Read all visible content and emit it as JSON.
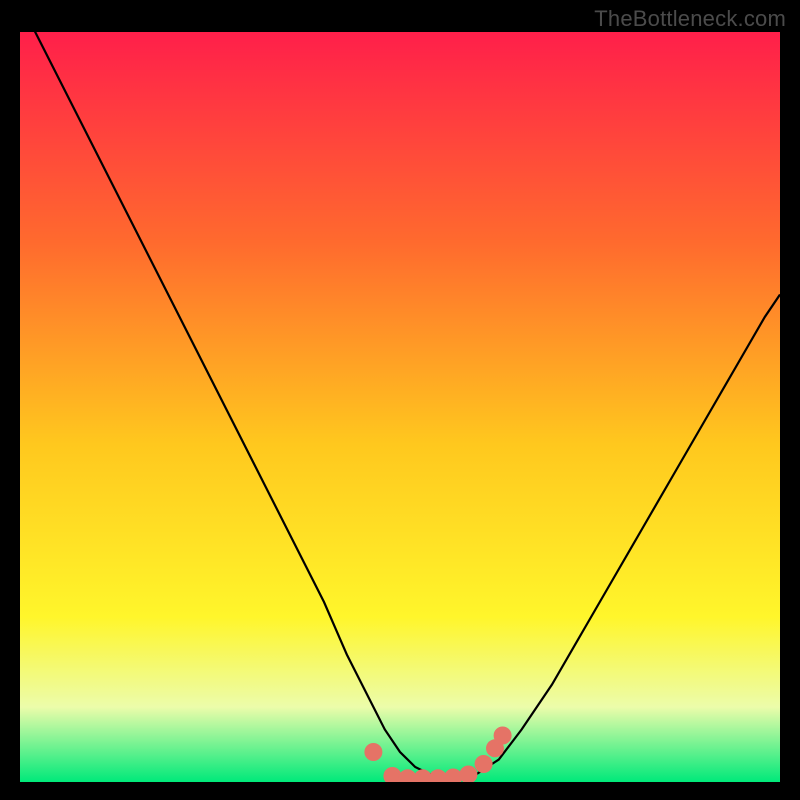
{
  "attribution": "TheBottleneck.com",
  "colors": {
    "frame": "#000000",
    "gradient_top": "#ff1f4a",
    "gradient_mid1": "#ff6a2e",
    "gradient_mid2": "#ffc81e",
    "gradient_mid3": "#fff62b",
    "gradient_mid4": "#ecfcaa",
    "gradient_bottom": "#00e97a",
    "curve": "#000000",
    "marker": "#e57366"
  },
  "chart_data": {
    "type": "line",
    "title": "",
    "xlabel": "",
    "ylabel": "",
    "xlim": [
      0,
      100
    ],
    "ylim": [
      0,
      100
    ],
    "series": [
      {
        "name": "bottleneck-curve",
        "x": [
          0,
          4,
          8,
          12,
          16,
          20,
          24,
          28,
          32,
          36,
          40,
          43,
          46,
          48,
          50,
          52,
          54,
          56,
          58,
          60,
          63,
          66,
          70,
          74,
          78,
          82,
          86,
          90,
          94,
          98,
          100
        ],
        "values": [
          104,
          96,
          88,
          80,
          72,
          64,
          56,
          48,
          40,
          32,
          24,
          17,
          11,
          7,
          4,
          2,
          1,
          0.5,
          0.5,
          1,
          3,
          7,
          13,
          20,
          27,
          34,
          41,
          48,
          55,
          62,
          65
        ]
      }
    ],
    "markers": [
      {
        "name": "left-edge-dot",
        "x": 46.5,
        "y": 4.0
      },
      {
        "name": "flat-start",
        "x": 49.0,
        "y": 0.8
      },
      {
        "name": "flat-a",
        "x": 51.0,
        "y": 0.5
      },
      {
        "name": "flat-b",
        "x": 53.0,
        "y": 0.5
      },
      {
        "name": "flat-c",
        "x": 55.0,
        "y": 0.5
      },
      {
        "name": "flat-d",
        "x": 57.0,
        "y": 0.6
      },
      {
        "name": "flat-end",
        "x": 59.0,
        "y": 1.0
      },
      {
        "name": "rise-a",
        "x": 61.0,
        "y": 2.4
      },
      {
        "name": "rise-b",
        "x": 62.5,
        "y": 4.5
      },
      {
        "name": "rise-c",
        "x": 63.5,
        "y": 6.2
      }
    ]
  }
}
